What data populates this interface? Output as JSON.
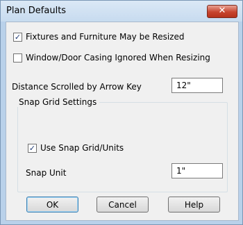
{
  "window": {
    "title": "Plan Defaults",
    "close_glyph": "✕"
  },
  "options": {
    "fixtures_resizable": {
      "label": "Fixtures and Furniture May be Resized",
      "checked": true
    },
    "casing_ignored": {
      "label": "Window/Door Casing Ignored When Resizing",
      "checked": false
    }
  },
  "arrow_key": {
    "label": "Distance Scrolled by Arrow Key",
    "value": "12\""
  },
  "snap_grid": {
    "title": "Snap Grid Settings",
    "use_snap": {
      "label": "Use Snap Grid/Units",
      "checked": true
    },
    "snap_unit": {
      "label": "Snap Unit",
      "value": "1\""
    }
  },
  "buttons": {
    "ok": "OK",
    "cancel": "Cancel",
    "help": "Help"
  },
  "check_glyph": "✓"
}
